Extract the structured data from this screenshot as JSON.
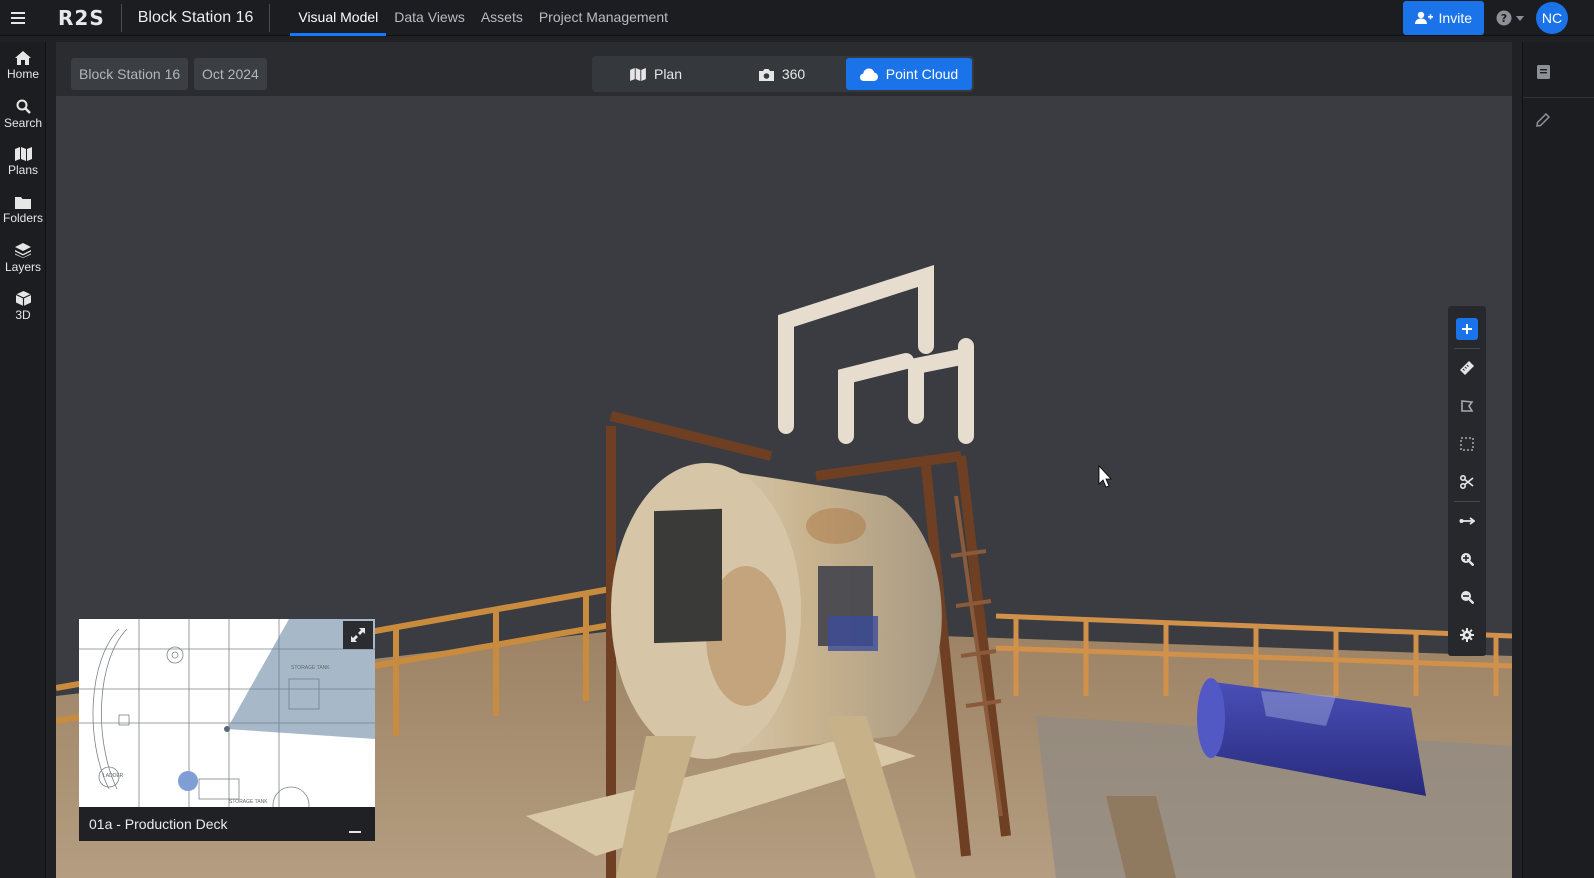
{
  "topbar": {
    "logo": "R2S",
    "project_title": "Block Station 16",
    "tabs": [
      {
        "label": "Visual Model",
        "active": true
      },
      {
        "label": "Data Views",
        "active": false
      },
      {
        "label": "Assets",
        "active": false
      },
      {
        "label": "Project Management",
        "active": false
      }
    ],
    "invite_label": "Invite",
    "avatar_initials": "NC"
  },
  "sidebar": {
    "items": [
      {
        "label": "Home",
        "icon": "home-icon"
      },
      {
        "label": "Search",
        "icon": "search-icon"
      },
      {
        "label": "Plans",
        "icon": "map-icon"
      },
      {
        "label": "Folders",
        "icon": "folder-icon"
      },
      {
        "label": "Layers",
        "icon": "layers-icon"
      },
      {
        "label": "3D",
        "icon": "cube-icon"
      }
    ]
  },
  "breadcrumb": {
    "site": "Block Station 16",
    "date": "Oct 2024"
  },
  "view_modes": [
    {
      "label": "Plan",
      "icon": "map-icon",
      "active": false
    },
    {
      "label": "360",
      "icon": "camera-icon",
      "active": false
    },
    {
      "label": "Point Cloud",
      "icon": "cloud-icon",
      "active": true
    }
  ],
  "tools": [
    "add-icon",
    "ruler-icon",
    "area-icon",
    "box-select-icon",
    "scissors-icon",
    "line-measure-icon",
    "zoom-in-icon",
    "zoom-out-icon",
    "settings-icon"
  ],
  "minimap": {
    "plan_name": "01a - Production Deck",
    "map_labels": [
      "STORAGE TANK",
      "LADDER",
      "STORAGE TANK"
    ]
  },
  "colors": {
    "accent": "#1a73e8",
    "background": "#3a3c41"
  }
}
